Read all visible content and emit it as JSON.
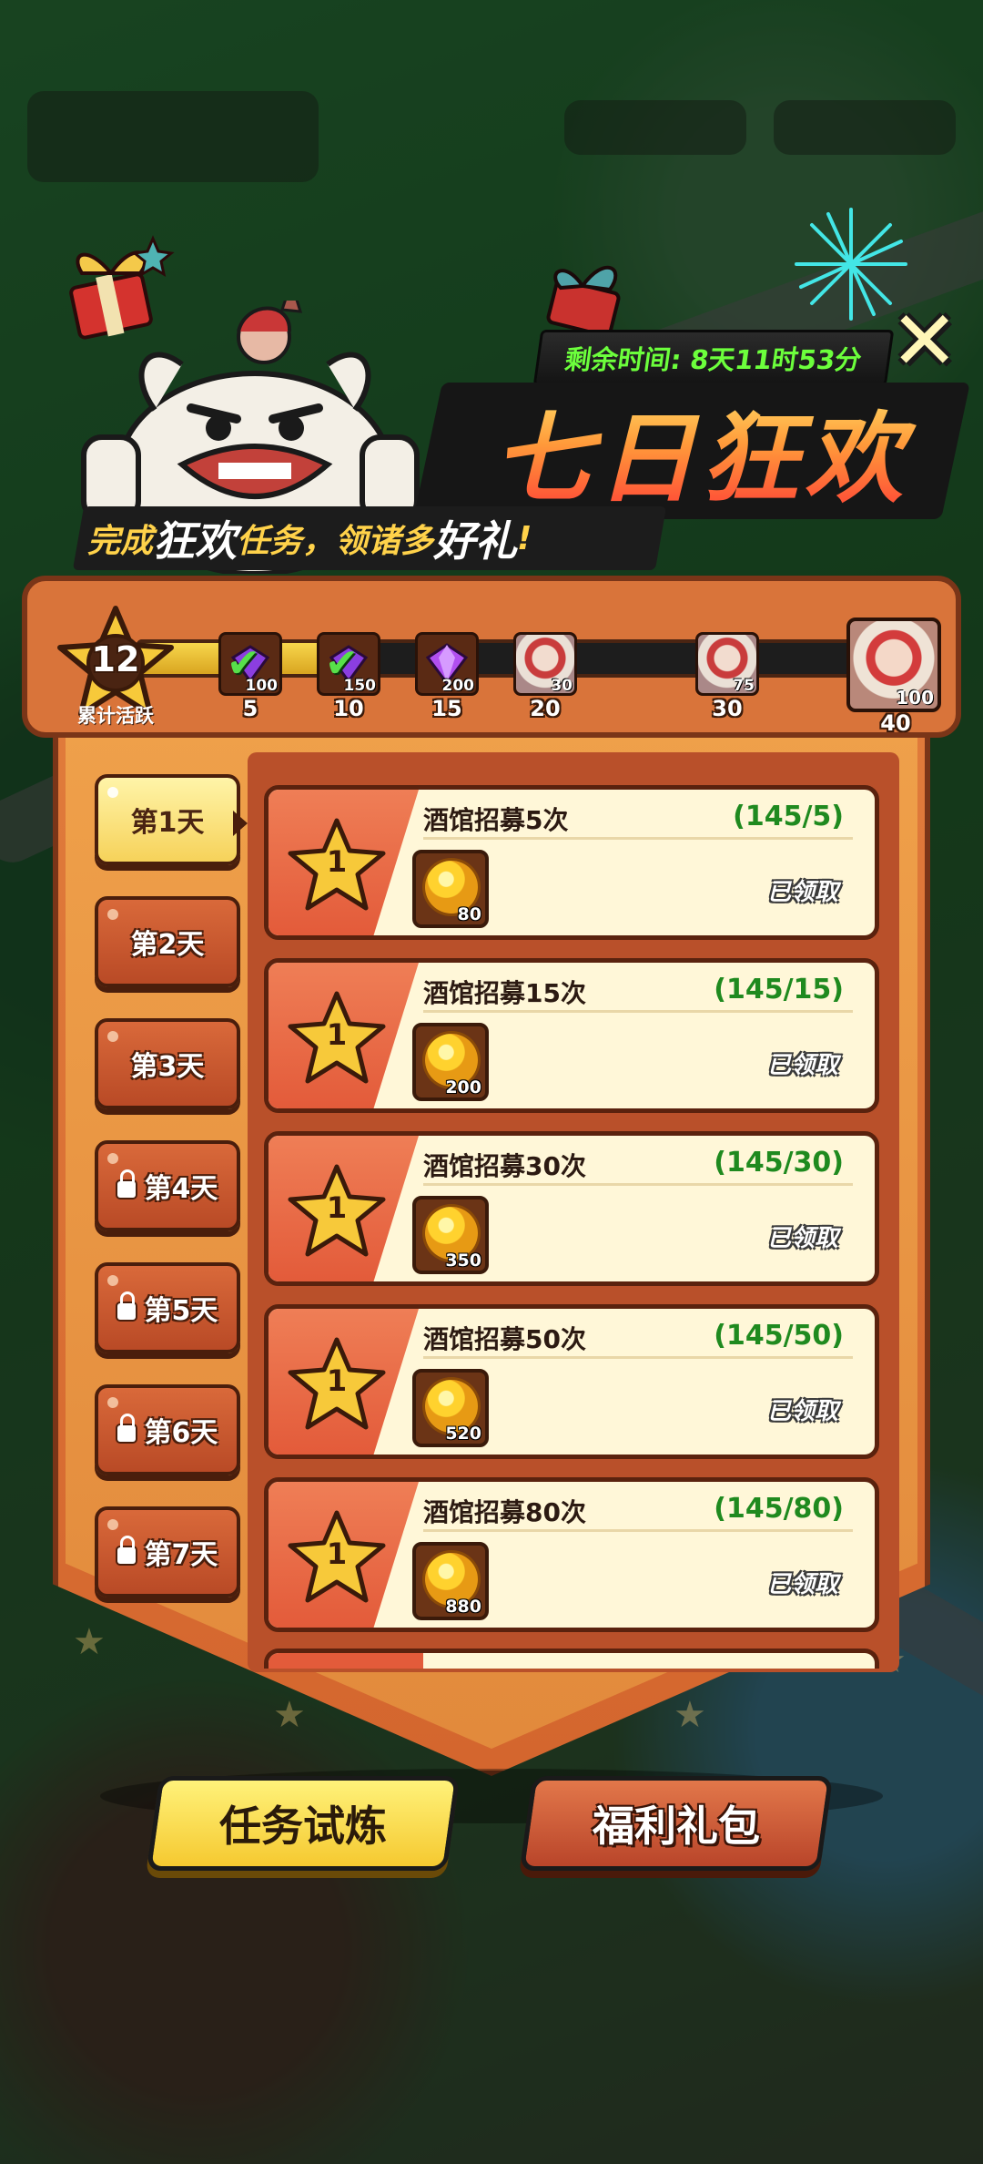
{
  "header": {
    "timer_text": "剩余时间: 8天11时53分",
    "title": "七日狂欢",
    "subtitle_a": "完成",
    "subtitle_b": "狂欢",
    "subtitle_c": "任务，领诸多",
    "subtitle_d": "好礼",
    "subtitle_e": "!"
  },
  "activity": {
    "score": "12",
    "score_label": "累计活跃",
    "progress_current": 12,
    "progress_max": 40,
    "milestones": [
      {
        "threshold": "5",
        "reward_qty": "100",
        "icon": "purple-gem-icon",
        "claimed": true
      },
      {
        "threshold": "10",
        "reward_qty": "150",
        "icon": "purple-gem-icon",
        "claimed": true
      },
      {
        "threshold": "15",
        "reward_qty": "200",
        "icon": "purple-gem-icon",
        "claimed": false
      },
      {
        "threshold": "20",
        "reward_qty": "30",
        "icon": "hero-portrait-icon",
        "claimed": false
      },
      {
        "threshold": "30",
        "reward_qty": "75",
        "icon": "hero-portrait-icon",
        "claimed": false
      }
    ],
    "final_reward": {
      "threshold": "40",
      "reward_qty": "100",
      "icon": "hero-portrait-icon"
    }
  },
  "days": [
    {
      "label": "第1天",
      "locked": false,
      "active": true
    },
    {
      "label": "第2天",
      "locked": false,
      "active": false
    },
    {
      "label": "第3天",
      "locked": false,
      "active": false
    },
    {
      "label": "第4天",
      "locked": true,
      "active": false
    },
    {
      "label": "第5天",
      "locked": true,
      "active": false
    },
    {
      "label": "第6天",
      "locked": true,
      "active": false
    },
    {
      "label": "第7天",
      "locked": true,
      "active": false
    }
  ],
  "tasks": [
    {
      "name": "酒馆招募5次",
      "progress": "(145/5)",
      "star": "1",
      "coin_qty": "80",
      "status": "已领取"
    },
    {
      "name": "酒馆招募15次",
      "progress": "(145/15)",
      "star": "1",
      "coin_qty": "200",
      "status": "已领取"
    },
    {
      "name": "酒馆招募30次",
      "progress": "(145/30)",
      "star": "1",
      "coin_qty": "350",
      "status": "已领取"
    },
    {
      "name": "酒馆招募50次",
      "progress": "(145/50)",
      "star": "1",
      "coin_qty": "520",
      "status": "已领取"
    },
    {
      "name": "酒馆招募80次",
      "progress": "(145/80)",
      "star": "1",
      "coin_qty": "880",
      "status": "已领取"
    }
  ],
  "buttons": {
    "tasks_tab": "任务试炼",
    "gift_tab": "福利礼包"
  },
  "colors": {
    "panel": "#e07b3b",
    "accent_yellow": "#f6d25a",
    "progress_green": "#1f8a1f",
    "timer_green": "#6cff3c"
  }
}
